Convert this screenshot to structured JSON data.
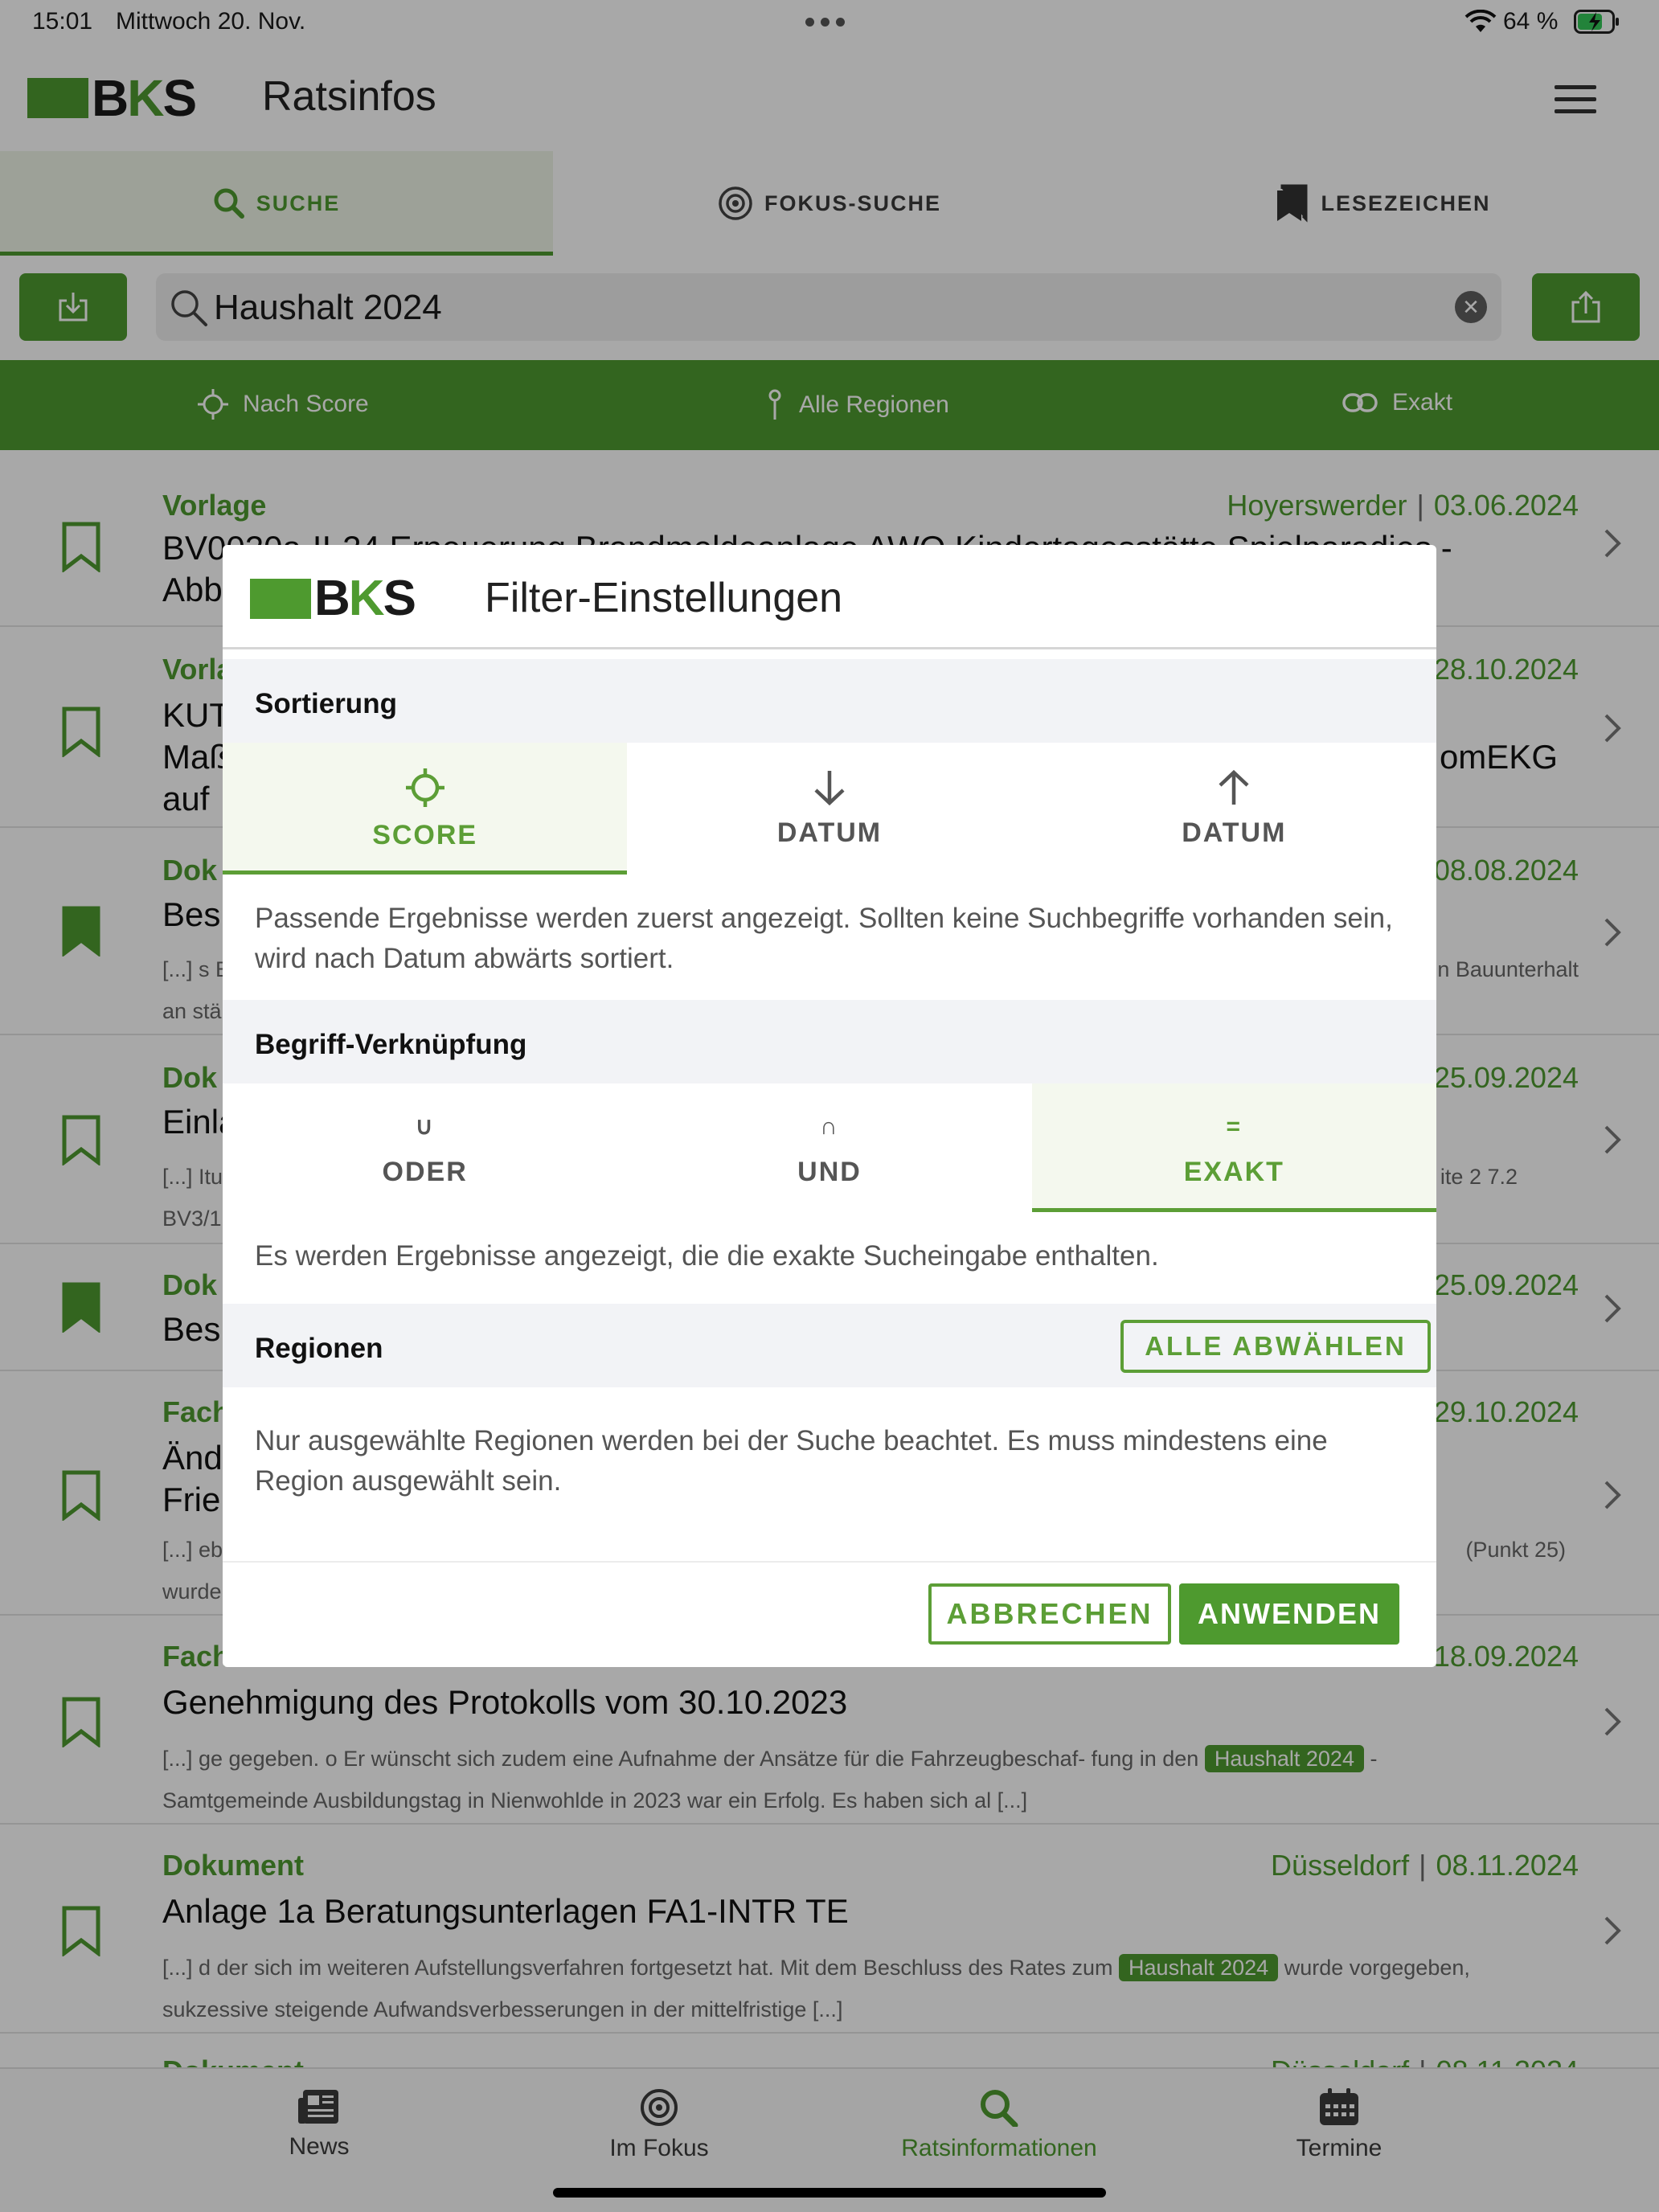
{
  "status_bar": {
    "time": "15:01",
    "date": "Mittwoch 20. Nov.",
    "battery": "64 %",
    "icons": [
      "wifi-icon",
      "battery-charging-icon"
    ]
  },
  "app": {
    "logo_text_1": "B",
    "logo_text_2": "K",
    "logo_text_3": "S",
    "title": "Ratsinfos"
  },
  "tabs": [
    {
      "label": "SUCHE",
      "icon": "search-icon",
      "active": true
    },
    {
      "label": "FOKUS-SUCHE",
      "icon": "target-icon",
      "active": false
    },
    {
      "label": "LESEZEICHEN",
      "icon": "bookmarks-icon",
      "active": false
    }
  ],
  "search": {
    "value": "Haushalt 2024"
  },
  "filter_bar": {
    "sort": "Nach Score",
    "regions": "Alle Regionen",
    "mode": "Exakt"
  },
  "results": [
    {
      "type": "Vorlage",
      "region": "Hoyerswerder",
      "date": "03.06.2024",
      "title_lines": [
        "BV0020a-II-24 Erneuerung Brandmeldeanlage AWO Kindertagesstätte Spielparadies -",
        "Abb"
      ],
      "bookmarked": false
    },
    {
      "type": "Vorla",
      "date": "28.10.2024",
      "title_lines": [
        "KUT",
        "Maß",
        "auf"
      ],
      "title_right": "omEKG",
      "bookmarked": false
    },
    {
      "type": "Dok",
      "date": "08.08.2024",
      "title_lines": [
        "Bes"
      ],
      "snippet_lines": [
        "[...] s B",
        "an stä"
      ],
      "snippet_right": "n Bauunterhalt",
      "bookmarked": true
    },
    {
      "type": "Dok",
      "date": "25.09.2024",
      "title_lines": [
        "Einla"
      ],
      "snippet_lines": [
        "[...] Itu",
        "BV3/1"
      ],
      "snippet_right": "ite 2 7.2",
      "bookmarked": false
    },
    {
      "type": "Dok",
      "date": "25.09.2024",
      "title_lines": [
        "Bes"
      ],
      "bookmarked": true
    },
    {
      "type": "Fach",
      "date": "29.10.2024",
      "title_lines": [
        "Änd",
        "Frie"
      ],
      "snippet_lines": [
        "[...] eb",
        "wurde"
      ],
      "snippet_right": "(Punkt 25)",
      "bookmarked": false
    },
    {
      "type": "Fach",
      "date": "18.09.2024",
      "title_lines": [
        "Genehmigung des Protokolls vom 30.10.2023"
      ],
      "snippet_pre": "[...] ge gegeben. o Er wünscht sich zudem eine Aufnahme der Ansätze für die Fahrzeugbeschaf- fung in den",
      "snippet_hl": "Haushalt 2024",
      "snippet_post": "-",
      "snippet_line2": "Samtgemeinde Ausbildungstag in Nienwohlde in 2023 war ein Erfolg. Es haben sich al [...]",
      "bookmarked": false
    },
    {
      "type": "Dokument",
      "region": "Düsseldorf",
      "date": "08.11.2024",
      "title_lines": [
        "Anlage 1a Beratungsunterlagen FA1-INTR TE"
      ],
      "snippet_pre": "[...] d der sich im weiteren Aufstellungsverfahren fortgesetzt hat. Mit dem Beschluss des Rates zum",
      "snippet_hl": "Haushalt 2024",
      "snippet_post": "wurde vorgegeben,",
      "snippet_line2": "sukzessive steigende Aufwandsverbesserungen in der mittelfristige [...]",
      "bookmarked": false
    },
    {
      "type": "Dokument",
      "region": "Düsseldorf",
      "date": "08.11.2024",
      "bookmarked": false
    }
  ],
  "bottom_nav": [
    {
      "label": "News",
      "icon": "newspaper-icon",
      "active": false
    },
    {
      "label": "Im Fokus",
      "icon": "target-icon",
      "active": false
    },
    {
      "label": "Ratsinformationen",
      "icon": "search-icon",
      "active": true
    },
    {
      "label": "Termine",
      "icon": "calendar-icon",
      "active": false
    }
  ],
  "dialog": {
    "title": "Filter-Einstellungen",
    "sort_section": {
      "heading": "Sortierung",
      "options": [
        {
          "label": "SCORE",
          "icon": "crosshair-icon",
          "active": true
        },
        {
          "label": "DATUM",
          "icon": "arrow-down-icon",
          "active": false
        },
        {
          "label": "DATUM",
          "icon": "arrow-up-icon",
          "active": false
        }
      ],
      "description": "Passende Ergebnisse werden zuerst angezeigt. Sollten keine Suchbegriffe vorhanden sein, wird nach Datum abwärts sortiert."
    },
    "link_section": {
      "heading": "Begriff-Verknüpfung",
      "options": [
        {
          "symbol": "∪",
          "label": "ODER",
          "active": false
        },
        {
          "symbol": "∩",
          "label": "UND",
          "active": false
        },
        {
          "symbol": "=",
          "label": "EXAKT",
          "active": true
        }
      ],
      "description": "Es werden Ergebnisse angezeigt, die die exakte Sucheingabe enthalten."
    },
    "region_section": {
      "heading": "Regionen",
      "deselect_label": "ALLE ABWÄHLEN",
      "description": "Nur ausgewählte Regionen werden bei der Suche beachtet. Es muss mindestens eine Region ausgewählt sein."
    },
    "cancel_label": "ABBRECHEN",
    "apply_label": "ANWENDEN"
  },
  "colors": {
    "brand_green": "#4e9a2f",
    "overlay": "rgba(0,0,0,0.34)"
  }
}
